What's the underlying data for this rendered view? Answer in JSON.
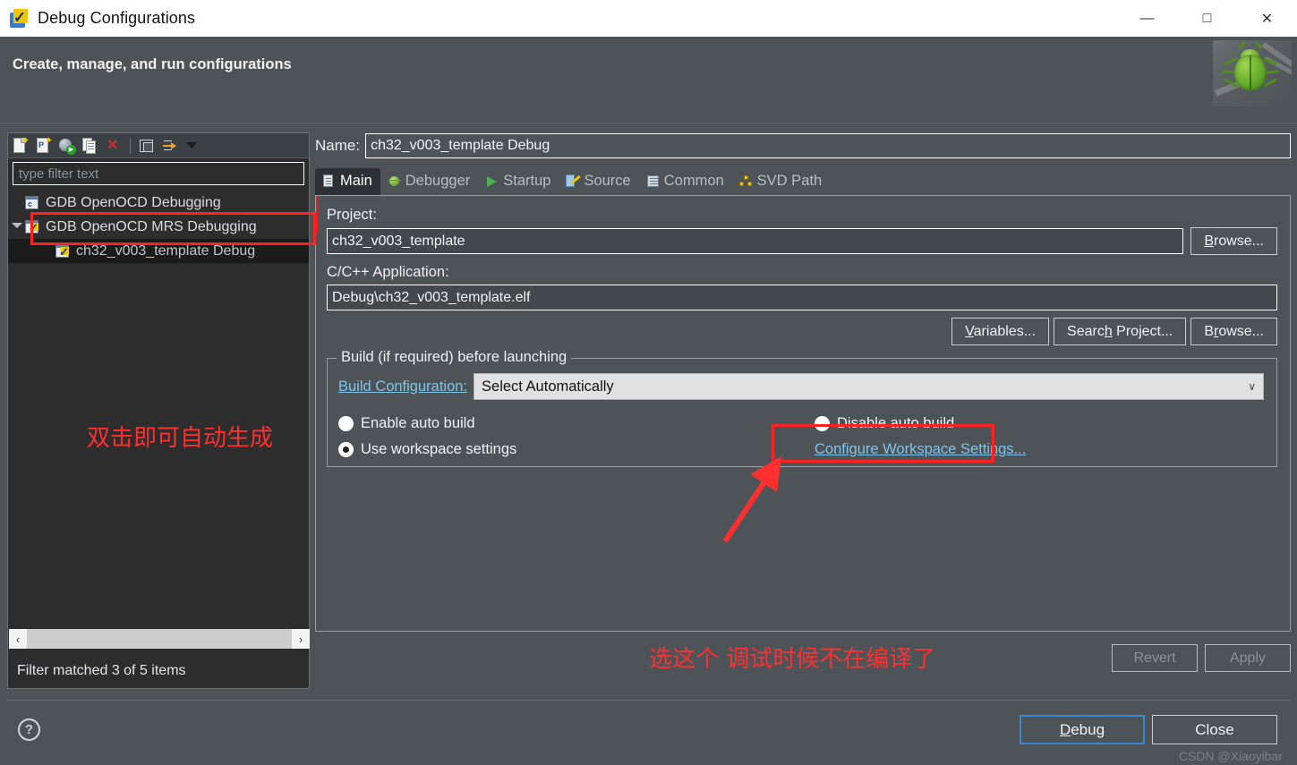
{
  "window": {
    "title": "Debug Configurations",
    "app_icon": "wizard-checkmark-icon",
    "minimize": "—",
    "maximize": "□",
    "close": "✕"
  },
  "header": {
    "title": "Create, manage, and run configurations",
    "badge_icon": "green-bug-icon"
  },
  "tree_panel": {
    "toolbar": [
      {
        "name": "new-launch-configuration-icon",
        "tooltip": "New launch configuration"
      },
      {
        "name": "new-prototype-icon",
        "tooltip": "New prototype"
      },
      {
        "name": "new-launch-group-icon",
        "tooltip": "New launch group"
      },
      {
        "name": "duplicate-icon",
        "tooltip": "Duplicate"
      },
      {
        "name": "delete-icon",
        "tooltip": "Delete"
      },
      {
        "name": "collapse-all-icon",
        "tooltip": "Collapse All"
      },
      {
        "name": "filter-icon",
        "tooltip": "Filter"
      },
      {
        "name": "chevron-down-icon",
        "tooltip": "View menu"
      }
    ],
    "filter_placeholder": "type filter text",
    "filter_value": "",
    "items": [
      {
        "label": "GDB OpenOCD Debugging",
        "icon": "config-c-icon",
        "level": 0,
        "selected": false,
        "expandable": false
      },
      {
        "label": "GDB OpenOCD MRS Debugging",
        "icon": "config-check-icon",
        "level": 0,
        "selected": false,
        "expandable": true,
        "highlighted": true
      },
      {
        "label": "ch32_v003_template Debug",
        "icon": "config-check-icon",
        "level": 1,
        "selected": true,
        "expandable": false
      }
    ],
    "annotation": "双击即可自动生成",
    "scroll_left": "‹",
    "scroll_right": "›",
    "status": "Filter matched 3 of 5 items"
  },
  "config": {
    "name_label": "Name:",
    "name_value": "ch32_v003_template Debug",
    "tabs": [
      {
        "label": "Main",
        "icon": "page-icon",
        "active": true
      },
      {
        "label": "Debugger",
        "icon": "bug-icon",
        "active": false
      },
      {
        "label": "Startup",
        "icon": "play-icon",
        "active": false
      },
      {
        "label": "Source",
        "icon": "source-icon",
        "active": false
      },
      {
        "label": "Common",
        "icon": "common-icon",
        "active": false
      },
      {
        "label": "SVD Path",
        "icon": "svd-icon",
        "active": false
      }
    ],
    "project_label": "Project:",
    "project_value": "ch32_v003_template",
    "project_browse": "Browse...",
    "project_browse_mnemonic": "B",
    "application_label": "C/C++ Application:",
    "application_value": "Debug\\ch32_v003_template.elf",
    "variables_button": "Variables...",
    "variables_mnemonic": "V",
    "search_project_button": "Search Project...",
    "search_project_mnemonic": "h",
    "app_browse_button": "Browse...",
    "app_browse_mnemonic": "r",
    "build_group_title": "Build (if required) before launching",
    "build_configuration_label": "Build Configuration:",
    "build_configuration_value": "Select Automatically",
    "build_configuration_chevron": "∨",
    "radio_enable_auto_build": "Enable auto build",
    "radio_enable_auto_build_selected": false,
    "radio_disable_auto_build": "Disable auto build",
    "radio_disable_auto_build_selected": false,
    "radio_use_workspace_settings": "Use workspace settings",
    "radio_use_workspace_settings_selected": true,
    "configure_workspace_link": "Configure Workspace Settings...",
    "annotation": "选这个 调试时候不在编译了",
    "revert_button": "Revert",
    "revert_disabled": true,
    "apply_button": "Apply",
    "apply_disabled": true
  },
  "footer": {
    "help_icon": "help-question-icon",
    "debug_button": "Debug",
    "debug_mnemonic": "D",
    "close_button": "Close",
    "watermark": "CSDN @Xiaoyibar"
  },
  "colors": {
    "window_bg": "#4e5358",
    "tree_bg": "#2d2d2d",
    "accent_link": "#7fc3e8",
    "annotation_red": "#ff2f2f",
    "focus_blue": "#3a87d0",
    "combo_bg": "#e1e1e1"
  }
}
